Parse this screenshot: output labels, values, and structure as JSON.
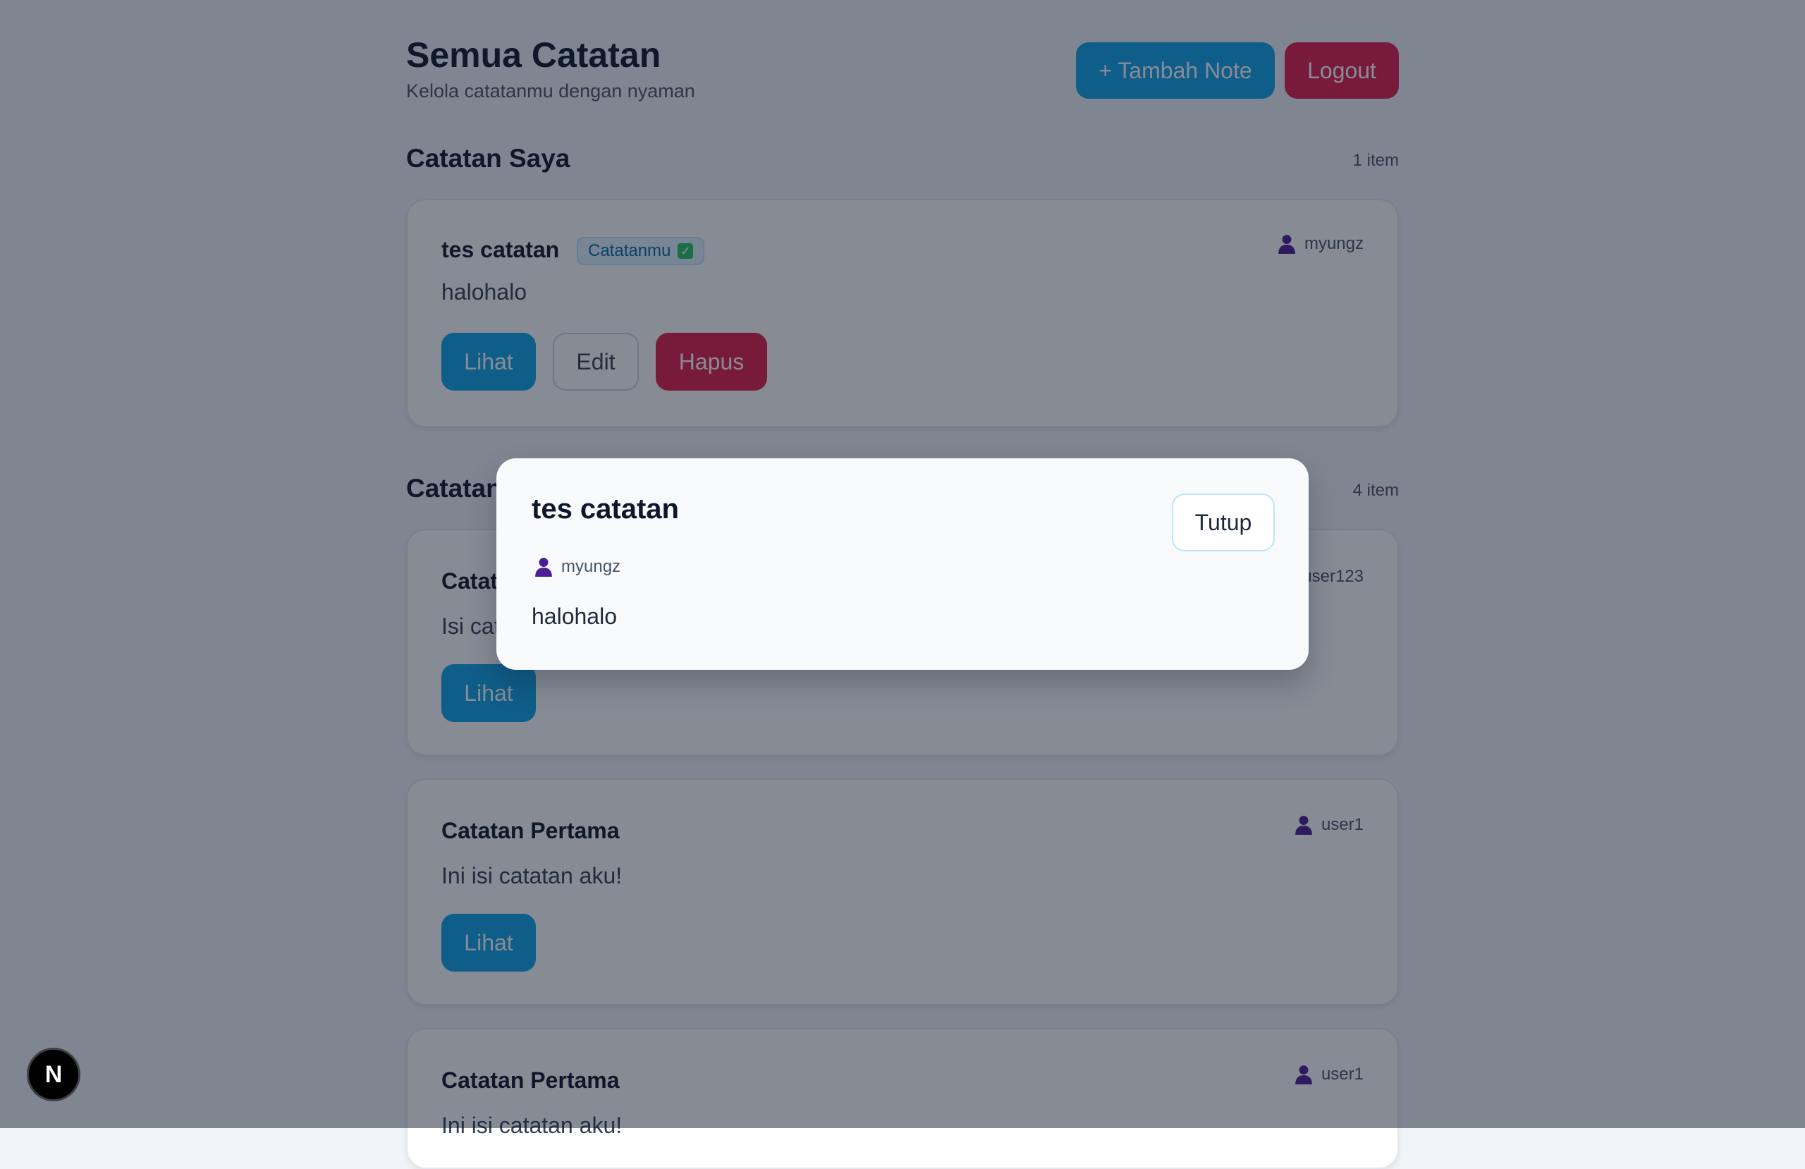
{
  "header": {
    "title": "Semua Catatan",
    "subtitle": "Kelola catatanmu dengan nyaman",
    "add_label": "+ Tambah Note",
    "logout_label": "Logout"
  },
  "my_notes": {
    "title": "Catatan Saya",
    "count": "1 item",
    "items": [
      {
        "title": "tes catatan",
        "badge": "Catatanmu",
        "owner": "myungz",
        "body": "halohalo",
        "view_label": "Lihat",
        "edit_label": "Edit",
        "delete_label": "Hapus"
      }
    ]
  },
  "all_notes": {
    "title": "Catatan",
    "count": "4 item",
    "items": [
      {
        "title": "Catat",
        "owner": "user123",
        "body": "Isi cat",
        "view_label": "Lihat"
      },
      {
        "title": "Catatan Pertama",
        "owner": "user1",
        "body": "Ini isi catatan aku!",
        "view_label": "Lihat"
      },
      {
        "title": "Catatan Pertama",
        "owner": "user1",
        "body": "Ini isi catatan aku!"
      }
    ]
  },
  "modal": {
    "title": "tes catatan",
    "owner": "myungz",
    "body": "halohalo",
    "close_label": "Tutup"
  },
  "dev_badge": {
    "label": "N"
  },
  "icons": {
    "owner": "user-icon",
    "mine": "check-icon"
  },
  "colors": {
    "primary": "#0ea5e9",
    "danger": "#e11d48",
    "overlay": "rgba(15,23,42,0.5)"
  }
}
